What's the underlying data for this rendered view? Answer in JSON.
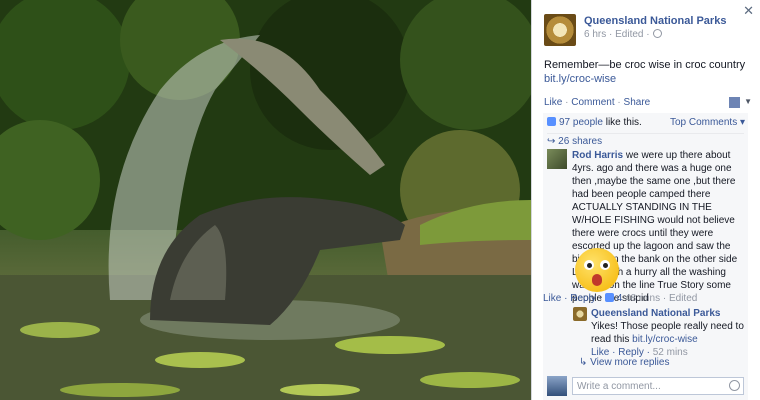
{
  "post": {
    "page_name": "Queensland National Parks",
    "meta": "6 hrs · Edited ·",
    "text": "Remember—be croc wise in croc country ",
    "link": "bit.ly/croc-wise",
    "actions": {
      "like": "Like",
      "comment": "Comment",
      "share": "Share",
      "sep": "·"
    }
  },
  "feedback": {
    "likes_count": "97 people",
    "likes_suffix": " like this.",
    "top_comments": "Top Comments ▾",
    "shares": "26 shares"
  },
  "comments": [
    {
      "author": "Rod Harris",
      "text": " we were up there about 4yrs. ago and there was a huge one then ,maybe the same one ,but there had been people camped there ACTUALLY STANDING IN THE W/HOLE FISHING would not believe there were crocs until they were escorted up the lagoon and saw the big one on the bank on the other side Left in such a hurry all the washing was left on the line True Story some people are stupid",
      "like": "Like",
      "reply": "Reply",
      "likes": "4",
      "time": "48 mins · Edited"
    }
  ],
  "reply": {
    "author": "Queensland National Parks",
    "text": " Yikes! Those people really need to read this ",
    "link": "bit.ly/croc-wise",
    "like": "Like",
    "reply": "Reply",
    "time": "52 mins"
  },
  "view_more": "View more replies",
  "composer": {
    "placeholder": "Write a comment..."
  },
  "icons": {
    "close": "close-icon",
    "emoji": "shocked-face-icon",
    "smile": "smiley-icon"
  },
  "colors": {
    "link": "#3b5998",
    "muted": "#9197a3",
    "feedback_bg": "#f6f7f9"
  }
}
